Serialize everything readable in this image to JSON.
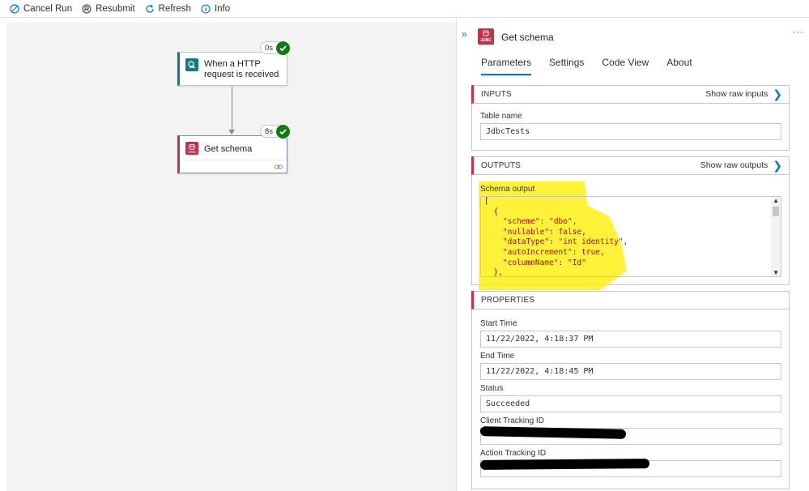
{
  "toolbar": {
    "cancel_label": "Cancel Run",
    "resubmit_label": "Resubmit",
    "refresh_label": "Refresh",
    "info_label": "Info"
  },
  "canvas": {
    "trigger": {
      "title": "When a HTTP request is received",
      "duration": "0s"
    },
    "action": {
      "title": "Get schema",
      "duration": "8s",
      "icon_text": "JDBC"
    }
  },
  "panel": {
    "title": "Get schema",
    "icon_text": "JDBC",
    "tabs": [
      "Parameters",
      "Settings",
      "Code View",
      "About"
    ],
    "active_tab": "Parameters",
    "inputs": {
      "title": "INPUTS",
      "raw_label": "Show raw inputs",
      "table_name_label": "Table name",
      "table_name_value": "JdbcTests"
    },
    "outputs": {
      "title": "OUTPUTS",
      "raw_label": "Show raw outputs",
      "schema_label": "Schema output",
      "code": {
        "l1": "[",
        "l2": "  {",
        "l3_key": "\"scheme\"",
        "l3_val": "\"dbo\"",
        "l4_key": "\"nullable\"",
        "l4_val": "false",
        "l5_key": "\"dataType\"",
        "l5_val": "\"int identity\"",
        "l6_key": "\"autoIncrement\"",
        "l6_val": "true",
        "l7_key": "\"columnName\"",
        "l7_val": "\"Id\"",
        "l8": "  },"
      }
    },
    "properties": {
      "title": "PROPERTIES",
      "start_label": "Start Time",
      "start_value": "11/22/2022, 4:18:37 PM",
      "end_label": "End Time",
      "end_value": "11/22/2022, 4:18:45 PM",
      "status_label": "Status",
      "status_value": "Succeeded",
      "client_label": "Client Tracking ID",
      "action_label": "Action Tracking ID"
    }
  },
  "colors": {
    "accent": "#0078d4",
    "jdbc_red": "#c4314b",
    "trigger_teal": "#0f7b83",
    "success_green": "#107c10",
    "highlight_yellow": "#ffee00"
  }
}
